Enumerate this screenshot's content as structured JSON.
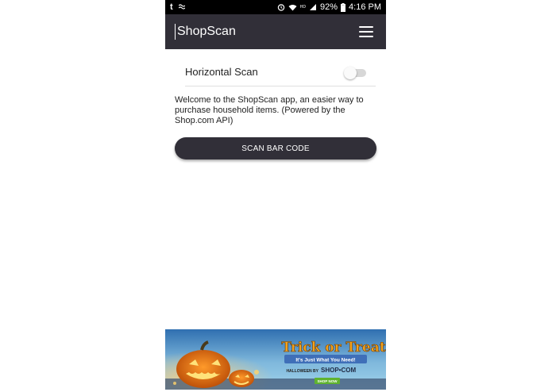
{
  "status_bar": {
    "battery": "92%",
    "time": "4:16 PM",
    "network": "HD",
    "left_icons": [
      "tumblr-icon",
      "notification-icon"
    ],
    "right_icons": [
      "alarm-icon",
      "wifi-icon",
      "signal-icon",
      "battery-icon"
    ]
  },
  "app_bar": {
    "title": "ShopScan",
    "menu_icon": "hamburger-menu-icon",
    "background": "#312f38"
  },
  "settings": {
    "horizontal_scan_label": "Horizontal Scan",
    "horizontal_scan_enabled": false
  },
  "main": {
    "welcome_text": "Welcome to the ShopScan app, an easier way to purchase household items. (Powered by the Shop.com API)",
    "scan_button_label": "SCAN BAR CODE"
  },
  "ad": {
    "headline": "Trick or Treat",
    "subline": "It's Just What You Need!",
    "tag_prefix": "HALLOWEEN BY",
    "brand": "SHOP•COM",
    "cta": "SHOP NOW"
  }
}
